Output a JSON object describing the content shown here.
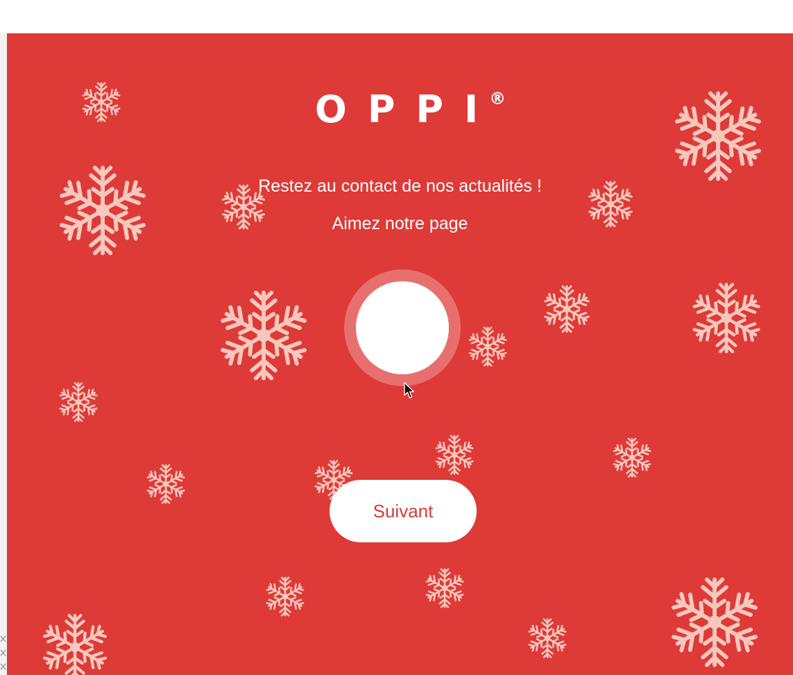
{
  "popup": {
    "brand_name": "OPPI",
    "brand_mark": "®",
    "tagline": "Restez au contact de nos actualités !",
    "cta_text": "Aimez notre page",
    "like_button_icon": "like-circle-icon",
    "next_button_label": "Suivant"
  },
  "colors": {
    "background": "#de3a37",
    "snowflake": "#f6c7bd",
    "text": "#ffffff",
    "button_text": "#d23b3a"
  },
  "decor": {
    "snowflake_icon": "snowflake-icon",
    "snowflake_count": 20
  }
}
